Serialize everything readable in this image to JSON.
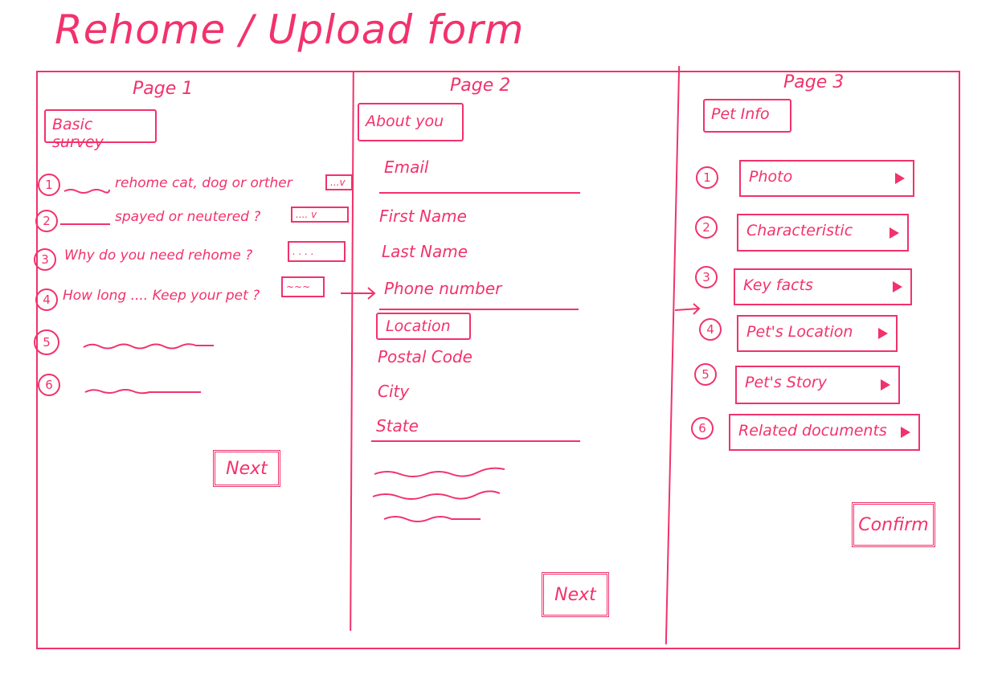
{
  "title": "Rehome / Upload form",
  "accent_color": "#f2326c",
  "page1": {
    "heading": "Page 1",
    "section": "Basic survey",
    "questions": [
      {
        "num": "1",
        "text": "rehome cat, dog or orther",
        "field": "...v"
      },
      {
        "num": "2",
        "text": "spayed or neutered ?",
        "field": ".... v"
      },
      {
        "num": "3",
        "text": "Why do you need rehome ?",
        "field": ". . . ."
      },
      {
        "num": "4",
        "text": "How long .... Keep your pet ?",
        "field": "~~~"
      },
      {
        "num": "5"
      },
      {
        "num": "6"
      }
    ],
    "next": "Next"
  },
  "page2": {
    "heading": "Page 2",
    "section": "About you",
    "email": "Email",
    "first_name": "First Name",
    "last_name": "Last Name",
    "phone": "Phone number",
    "location": "Location",
    "postal_code": "Postal Code",
    "city": "City",
    "state": "State",
    "next": "Next"
  },
  "page3": {
    "heading": "Page 3",
    "section": "Pet Info",
    "items": [
      {
        "num": "1",
        "label": "Photo"
      },
      {
        "num": "2",
        "label": "Characteristic"
      },
      {
        "num": "3",
        "label": "Key facts"
      },
      {
        "num": "4",
        "label": "Pet's Location"
      },
      {
        "num": "5",
        "label": "Pet's Story"
      },
      {
        "num": "6",
        "label": "Related documents"
      }
    ],
    "confirm": "Confirm"
  }
}
